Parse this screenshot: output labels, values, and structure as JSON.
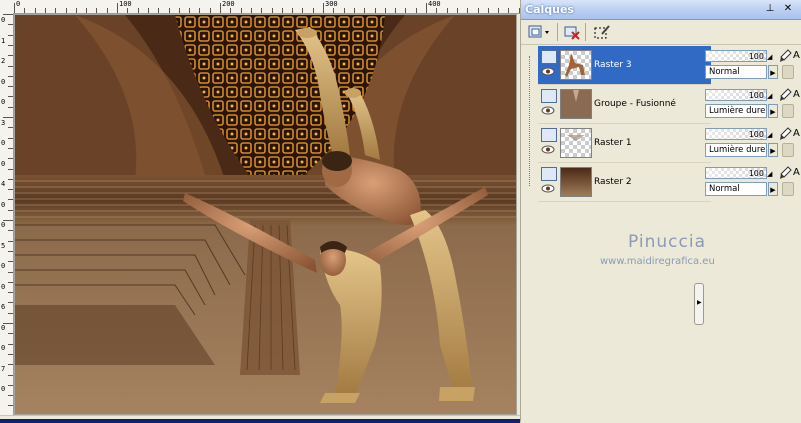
{
  "ruler": {
    "top_labels": [
      "0",
      "100",
      "200",
      "300",
      "400",
      "500"
    ],
    "left_labels": [
      "0",
      "1",
      "2",
      "0",
      "0",
      "3",
      "0",
      "0",
      "4",
      "0",
      "0",
      "5",
      "0",
      "0",
      "6",
      "0",
      "0",
      "7",
      "0"
    ]
  },
  "layers_panel": {
    "title": "Calques",
    "title_controls": [
      "pin-icon",
      "close-icon"
    ],
    "layers": [
      {
        "name": "Raster 3",
        "selected": true,
        "opacity": "100",
        "blend_mode": "Normal",
        "thumbnail": "dancers"
      },
      {
        "name": "Groupe - Fusionné",
        "selected": false,
        "opacity": "100",
        "blend_mode": "Lumière dure",
        "thumbnail": "drape"
      },
      {
        "name": "Raster 1",
        "selected": false,
        "opacity": "100",
        "blend_mode": "Lumière dure",
        "thumbnail": "transparent"
      },
      {
        "name": "Raster 2",
        "selected": false,
        "opacity": "100",
        "blend_mode": "Normal",
        "thumbnail": "brown"
      }
    ],
    "truncated_prefix": "A"
  },
  "watermark": {
    "name": "Pinuccia",
    "url": "www.maidiregrafica.eu"
  },
  "colors": {
    "selection": "#316ac5",
    "panel_bg": "#ece9d8",
    "title_gradient_start": "#d9e4f9",
    "canvas_brown": "#5a3520",
    "watermark": "#8a9bb5"
  }
}
